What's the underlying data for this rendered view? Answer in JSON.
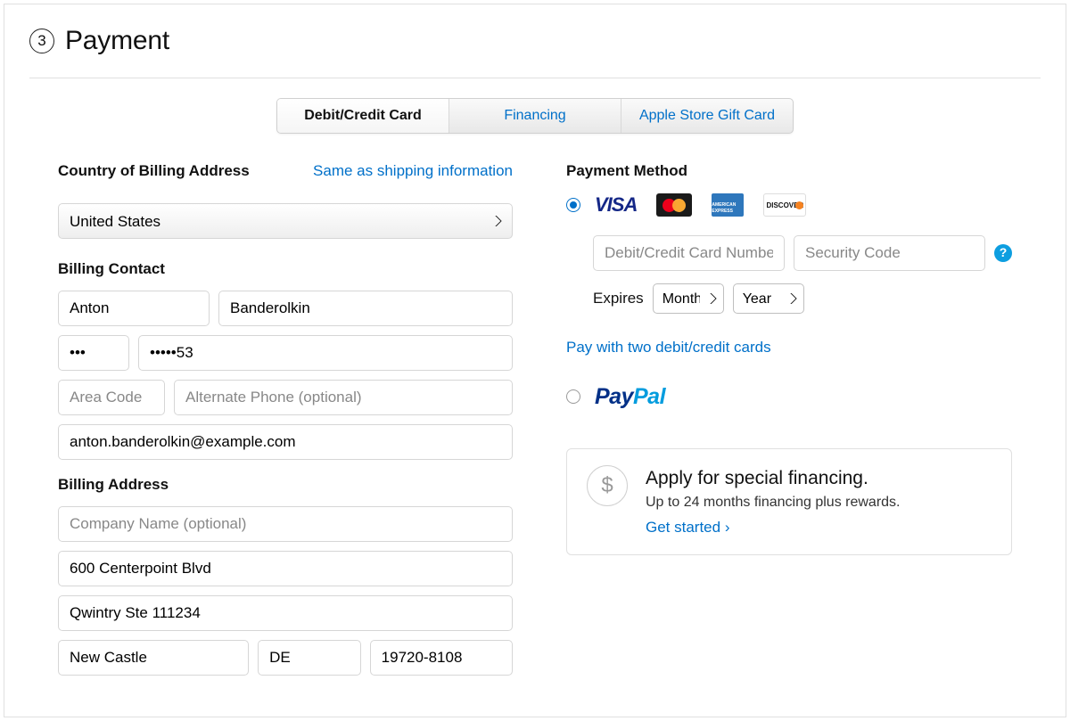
{
  "header": {
    "step_number": "3",
    "title": "Payment"
  },
  "tabs": {
    "debit_credit": "Debit/Credit Card",
    "financing": "Financing",
    "gift_card": "Apple Store Gift Card"
  },
  "left": {
    "country_label": "Country of Billing Address",
    "same_as_shipping": "Same as shipping information",
    "country_value": "United States",
    "billing_contact_label": "Billing Contact",
    "first_name": "Anton",
    "last_name": "Banderolkin",
    "phone_area_value": "•••",
    "phone_number_value": "•••••53",
    "alt_area_placeholder": "Area Code",
    "alt_phone_placeholder": "Alternate Phone (optional)",
    "email_value": "anton.banderolkin@example.com",
    "billing_address_label": "Billing Address",
    "company_placeholder": "Company Name (optional)",
    "street1": "600 Centerpoint Blvd",
    "street2": "Qwintry Ste 111234",
    "city": "New Castle",
    "state": "DE",
    "zip": "19720-8108"
  },
  "right": {
    "payment_method_label": "Payment Method",
    "card_number_placeholder": "Debit/Credit Card Number",
    "security_code_placeholder": "Security Code",
    "expires_label": "Expires",
    "month_label": "Month",
    "year_label": "Year",
    "two_cards_link": "Pay with two debit/credit cards",
    "paypal_p1": "Pay",
    "paypal_p2": "Pal",
    "promo_title": "Apply for special financing.",
    "promo_sub": "Up to 24 months financing plus rewards.",
    "promo_link": "Get started ›",
    "visa_text": "VISA",
    "amex_text": "AMERICAN EXPRESS",
    "discover_text": "DISCOVER",
    "help_icon": "?",
    "dollar_icon": "$"
  }
}
